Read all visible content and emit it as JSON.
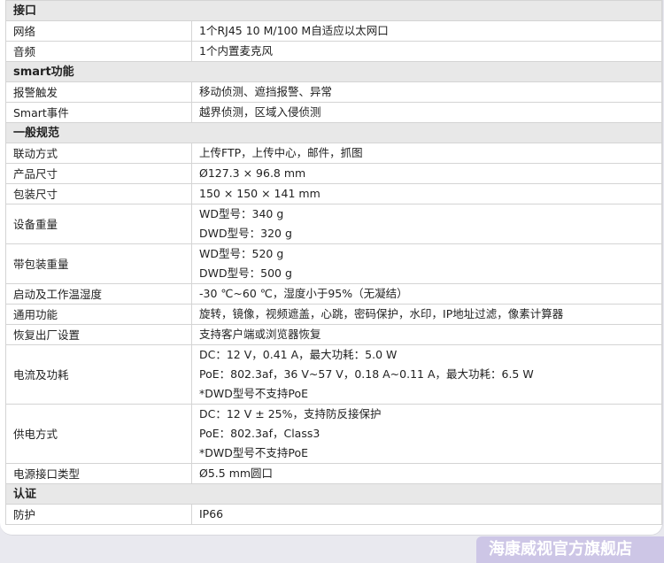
{
  "sections": [
    {
      "title": "接口",
      "rows": [
        {
          "key": "网络",
          "lines": [
            "1个RJ45 10 M/100 M自适应以太网口"
          ]
        },
        {
          "key": "音频",
          "lines": [
            "1个内置麦克风"
          ]
        }
      ]
    },
    {
      "title": "smart功能",
      "rows": [
        {
          "key": "报警触发",
          "lines": [
            "移动侦测、遮挡报警、异常"
          ]
        },
        {
          "key": "Smart事件",
          "lines": [
            "越界侦测，区域入侵侦测"
          ]
        }
      ]
    },
    {
      "title": "一般规范",
      "rows": [
        {
          "key": "联动方式",
          "lines": [
            "上传FTP，上传中心，邮件，抓图"
          ]
        },
        {
          "key": "产品尺寸",
          "lines": [
            "Ø127.3 × 96.8 mm"
          ]
        },
        {
          "key": "包装尺寸",
          "lines": [
            "150 × 150 × 141 mm"
          ]
        },
        {
          "key": "设备重量",
          "lines": [
            "WD型号：340 g",
            "DWD型号：320 g"
          ]
        },
        {
          "key": "带包装重量",
          "lines": [
            "WD型号：520 g",
            "DWD型号：500 g"
          ]
        },
        {
          "key": "启动及工作温湿度",
          "lines": [
            "-30 ℃~60 ℃，湿度小于95%（无凝结）"
          ]
        },
        {
          "key": "通用功能",
          "lines": [
            "旋转，镜像，视频遮盖，心跳，密码保护，水印，IP地址过滤，像素计算器"
          ]
        },
        {
          "key": "恢复出厂设置",
          "lines": [
            "支持客户端或浏览器恢复"
          ]
        },
        {
          "key": "电流及功耗",
          "lines": [
            "DC：12 V，0.41 A，最大功耗：5.0 W",
            "PoE：802.3af，36 V~57 V，0.18 A~0.11 A，最大功耗：6.5 W",
            "*DWD型号不支持PoE"
          ]
        },
        {
          "key": "供电方式",
          "lines": [
            "DC：12 V ± 25%，支持防反接保护",
            "PoE：802.3af，Class3",
            "*DWD型号不支持PoE"
          ]
        },
        {
          "key": "电源接口类型",
          "lines": [
            "Ø5.5 mm圆口"
          ]
        }
      ]
    },
    {
      "title": "认证",
      "rows": [
        {
          "key": "防护",
          "lines": [
            "IP66"
          ]
        }
      ]
    }
  ],
  "watermark": "海康威视官方旗舰店"
}
